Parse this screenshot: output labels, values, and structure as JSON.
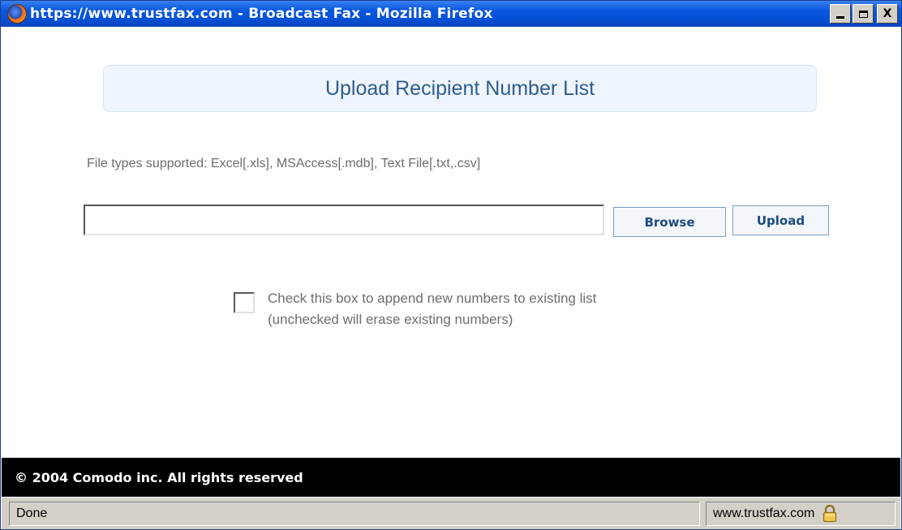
{
  "window": {
    "title": "https://www.trustfax.com - Broadcast Fax - Mozilla Firefox",
    "controls": {
      "minimize": "",
      "maximize": "",
      "close": "X"
    }
  },
  "main": {
    "heading": "Upload Recipient Number List",
    "file_types": "File types supported: Excel[.xls], MSAccess[.mdb], Text File[.txt,.csv]",
    "file_input": {
      "value": "",
      "placeholder": ""
    },
    "browse_label": "Browse",
    "upload_label": "Upload",
    "append_checkbox": {
      "checked": false,
      "line1": "Check this box to append new numbers to existing list",
      "line2": "(unchecked will erase existing numbers)"
    }
  },
  "footer": {
    "copyright": "© 2004 Comodo inc. All rights reserved"
  },
  "statusbar": {
    "status": "Done",
    "domain": "www.trustfax.com",
    "icon": "padlock-icon"
  },
  "colors": {
    "titlebar": "#0551d6",
    "heading_text": "#2f5c8f",
    "heading_box": "#eef5fd",
    "footer": "#000000",
    "statusbar": "#d4d0c8",
    "padlock": "#f2c84b"
  }
}
